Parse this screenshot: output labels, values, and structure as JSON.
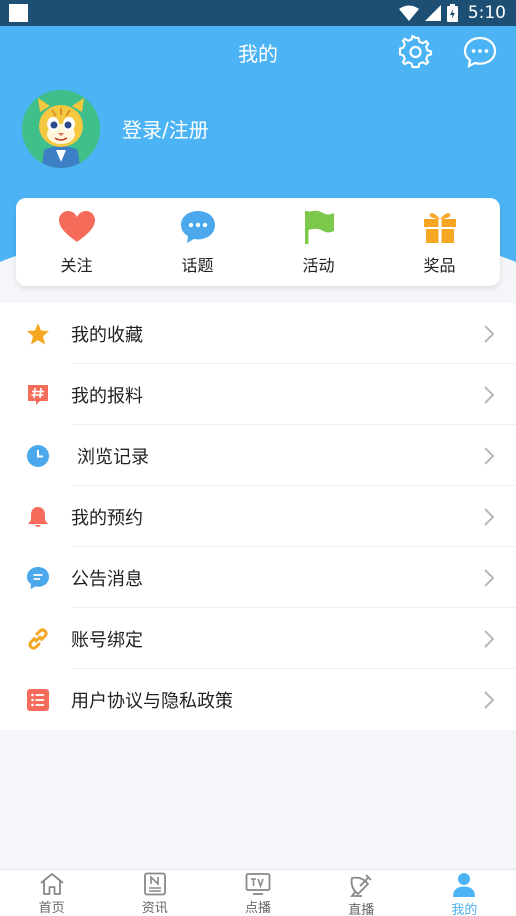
{
  "status_bar": {
    "time": "5:10"
  },
  "header": {
    "title": "我的",
    "login_text": "登录/注册"
  },
  "quick_actions": [
    {
      "label": "关注",
      "icon": "heart-icon",
      "color": "#f56c5a"
    },
    {
      "label": "话题",
      "icon": "chat-bubble-icon",
      "color": "#4ca8ec"
    },
    {
      "label": "活动",
      "icon": "flag-icon",
      "color": "#7cc84a"
    },
    {
      "label": "奖品",
      "icon": "gift-icon",
      "color": "#f5a623"
    }
  ],
  "menu": [
    {
      "label": "我的收藏",
      "icon": "star-icon",
      "color": "#f5a623"
    },
    {
      "label": "我的报料",
      "icon": "hashtag-icon",
      "color": "#f56c5a"
    },
    {
      "label": "浏览记录",
      "icon": "clock-icon",
      "color": "#4ca8ec"
    },
    {
      "label": "我的预约",
      "icon": "bell-icon",
      "color": "#f56c5a"
    },
    {
      "label": "公告消息",
      "icon": "message-icon",
      "color": "#4ca8ec"
    },
    {
      "label": "账号绑定",
      "icon": "link-icon",
      "color": "#f5a623"
    },
    {
      "label": "用户协议与隐私政策",
      "icon": "list-icon",
      "color": "#f56c5a"
    }
  ],
  "tabs": [
    {
      "label": "首页",
      "icon": "home-icon",
      "active": false
    },
    {
      "label": "资讯",
      "icon": "news-icon",
      "active": false
    },
    {
      "label": "点播",
      "icon": "tv-icon",
      "active": false
    },
    {
      "label": "直播",
      "icon": "satellite-icon",
      "active": false
    },
    {
      "label": "我的",
      "icon": "user-icon",
      "active": true
    }
  ],
  "colors": {
    "header_bg": "#4cb4f5",
    "active_tab": "#4cb4f5",
    "status_bar": "#1c4f73"
  }
}
